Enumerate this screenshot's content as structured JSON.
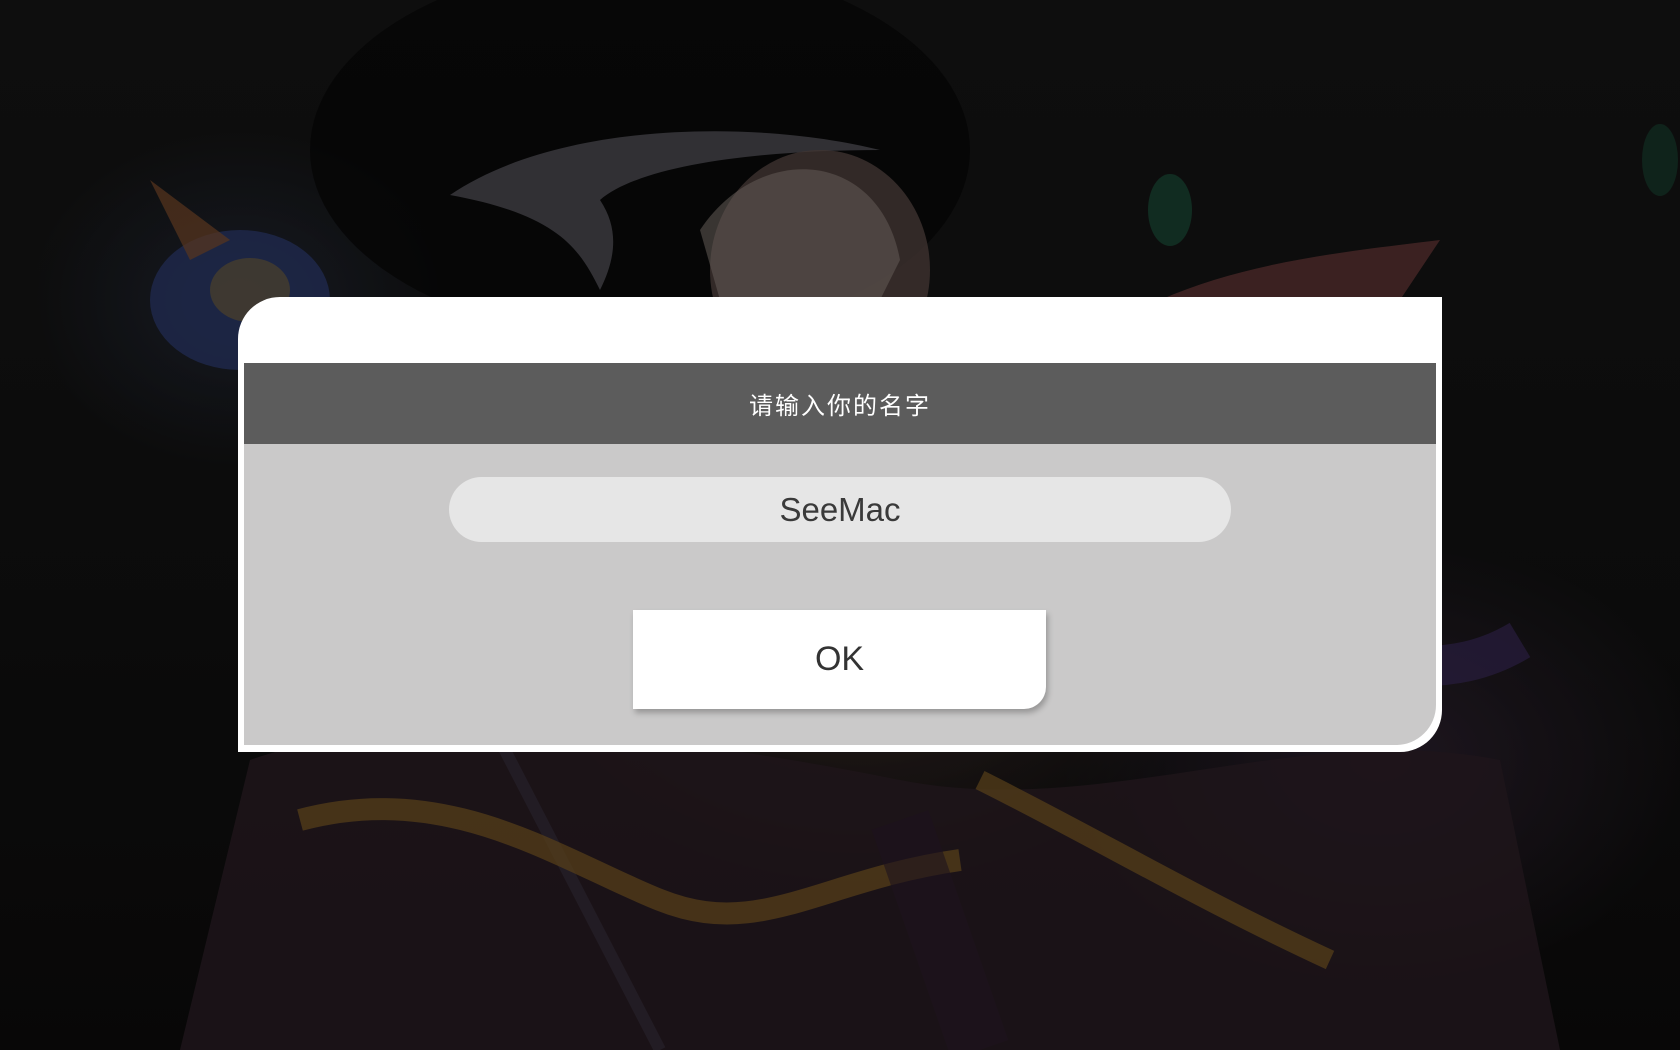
{
  "dialog": {
    "title": "请输入你的名字",
    "name_value": "SeeMac",
    "ok_label": "OK"
  },
  "background": {
    "description_icon": "game-character-artwork"
  }
}
